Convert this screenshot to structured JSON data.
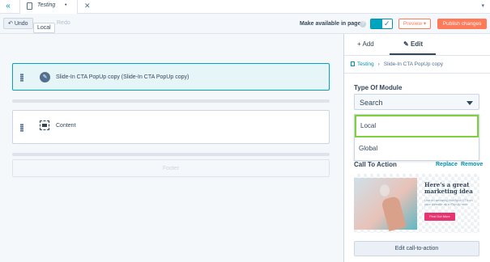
{
  "topbar": {
    "tab_title": "Testing",
    "tab_dot": "•",
    "close_glyph": "✕",
    "back_glyph": "«",
    "menu_glyph": "▾"
  },
  "toolbar": {
    "undo_label": "Undo",
    "redo_label": "Redo",
    "tooltip": "Local",
    "make_available_label": "Make available in pages",
    "preview_label": "Preview ▾",
    "publish_label": "Publish changes"
  },
  "canvas": {
    "modules": [
      {
        "label": "Slide-In CTA PopUp copy (Slide-In CTA PopUp copy)",
        "selected": true
      },
      {
        "label": "Content",
        "selected": false
      }
    ],
    "footer_label": "Footer"
  },
  "panel": {
    "tabs": [
      {
        "label": "Add",
        "icon": "plus-icon",
        "active": false
      },
      {
        "label": "Edit",
        "icon": "pencil-icon",
        "active": true
      }
    ],
    "breadcrumb": {
      "root": "Testing",
      "current": "Slide-In CTA PopUp copy"
    },
    "type_of_module_label": "Type Of Module",
    "select_value": "Search",
    "dropdown_options": [
      "Local",
      "Global"
    ],
    "highlighted_option": "Local",
    "call_to_action_label": "Call To Action",
    "replace_label": "Replace",
    "remove_label": "Remove",
    "cta_preview": {
      "heading": "Here's a great marketing idea",
      "subtext": "Use an amazing HubSpot CTA on your website as a PopUp here",
      "button": "Find Out More"
    },
    "edit_cta_label": "Edit call-to-action"
  },
  "colors": {
    "accent": "#00a4bd",
    "link": "#0091ae",
    "publish": "#ff7a59",
    "highlight_border": "#7fd13b",
    "text": "#33475b"
  }
}
